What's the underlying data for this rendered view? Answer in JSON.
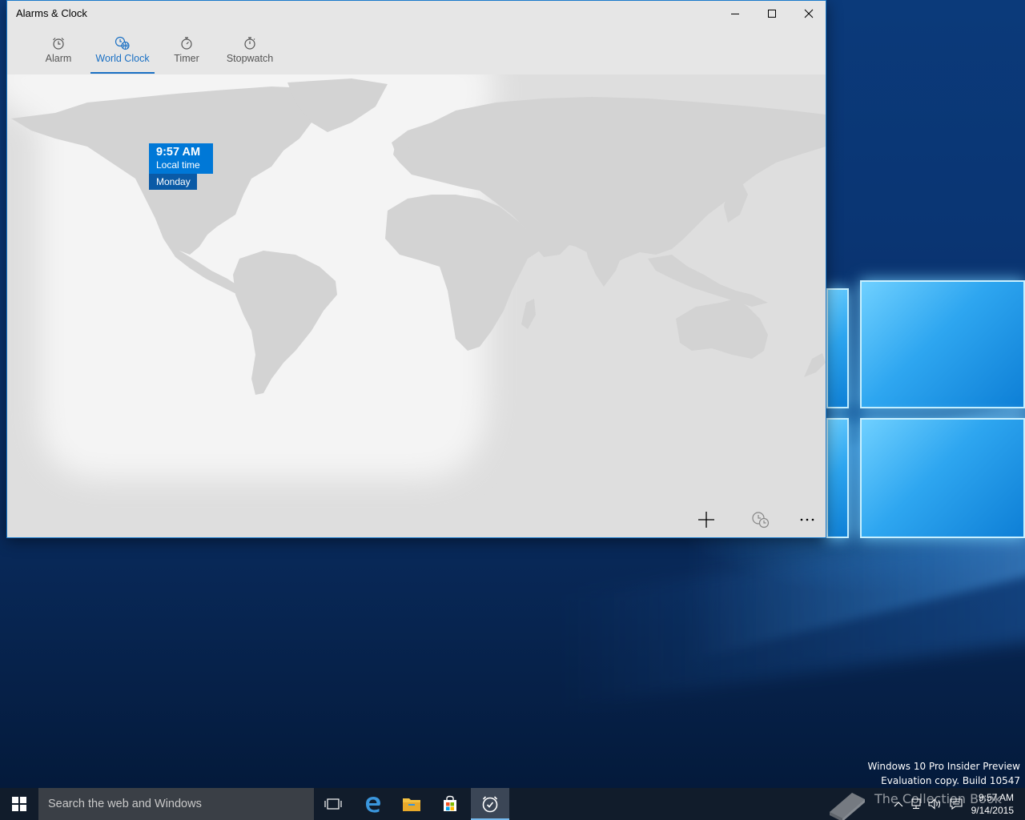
{
  "window": {
    "title": "Alarms & Clock",
    "controls": {
      "minimize": "minimize",
      "maximize": "maximize",
      "close": "close"
    }
  },
  "tabs": [
    {
      "label": "Alarm",
      "icon": "alarm-clock-icon",
      "selected": false
    },
    {
      "label": "World Clock",
      "icon": "globe-clock-icon",
      "selected": true
    },
    {
      "label": "Timer",
      "icon": "timer-icon",
      "selected": false
    },
    {
      "label": "Stopwatch",
      "icon": "stopwatch-icon",
      "selected": false
    }
  ],
  "world_clock": {
    "time": "9:57 AM",
    "label": "Local time",
    "day": "Monday"
  },
  "app_bar": {
    "add": "add-icon",
    "compare": "compare-clocks-icon",
    "more": "more-icon"
  },
  "desktop": {
    "watermark_line1": "Windows 10 Pro Insider Preview",
    "watermark_line2": "Evaluation copy. Build 10547"
  },
  "taskbar": {
    "search_placeholder": "Search the web and Windows",
    "apps": [
      "task-view-icon",
      "edge-icon",
      "file-explorer-icon",
      "store-icon",
      "alarms-clock-icon"
    ],
    "tray_watermark": "The Collection Book",
    "clock_time": "9:57 AM",
    "clock_date": "9/14/2015"
  },
  "colors": {
    "accent": "#0078d7",
    "accent_dark": "#0a5aa6",
    "land": "#d5d5d5",
    "window_bg": "#f2f2f2",
    "taskbar": "#111c2b"
  }
}
